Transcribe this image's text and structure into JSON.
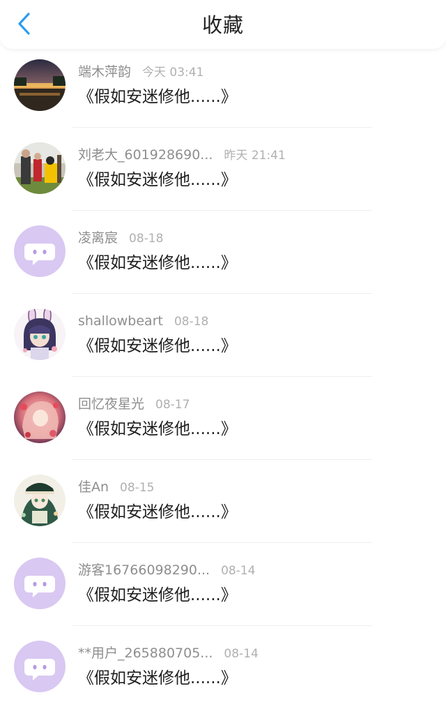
{
  "header": {
    "title": "收藏",
    "back_icon": "chevron-left-icon",
    "accent_color": "#2d9cf0"
  },
  "items": [
    {
      "name": "端木萍韵",
      "time": "今天 03:41",
      "message": "《假如安迷修他......》",
      "avatar": "sunset-photo"
    },
    {
      "name": "刘老大_601928690...",
      "time": "昨天 21:41",
      "message": "《假如安迷修他......》",
      "avatar": "people-photo"
    },
    {
      "name": "凌离宸",
      "time": "08-18",
      "message": "《假如安迷修他......》",
      "avatar": "default-chat-bubble-icon"
    },
    {
      "name": "shallowbeart",
      "time": "08-18",
      "message": "《假如安迷修他......》",
      "avatar": "anime-girl-bunny-ears"
    },
    {
      "name": "回忆夜星光",
      "time": "08-17",
      "message": "《假如安迷修他......》",
      "avatar": "anime-girl-pink"
    },
    {
      "name": "佳An",
      "time": "08-15",
      "message": "《假如安迷修他......》",
      "avatar": "anime-girl-green-hat"
    },
    {
      "name": "游客16766098290...",
      "time": "08-14",
      "message": "《假如安迷修他......》",
      "avatar": "default-chat-bubble-icon"
    },
    {
      "name": "**用户_265880705...",
      "time": "08-14",
      "message": "《假如安迷修他......》",
      "avatar": "default-chat-bubble-icon"
    }
  ],
  "colors": {
    "default_avatar_bg": "#d9c8f2",
    "name_text": "#8e8e8e",
    "time_text": "#b0b0b0"
  }
}
